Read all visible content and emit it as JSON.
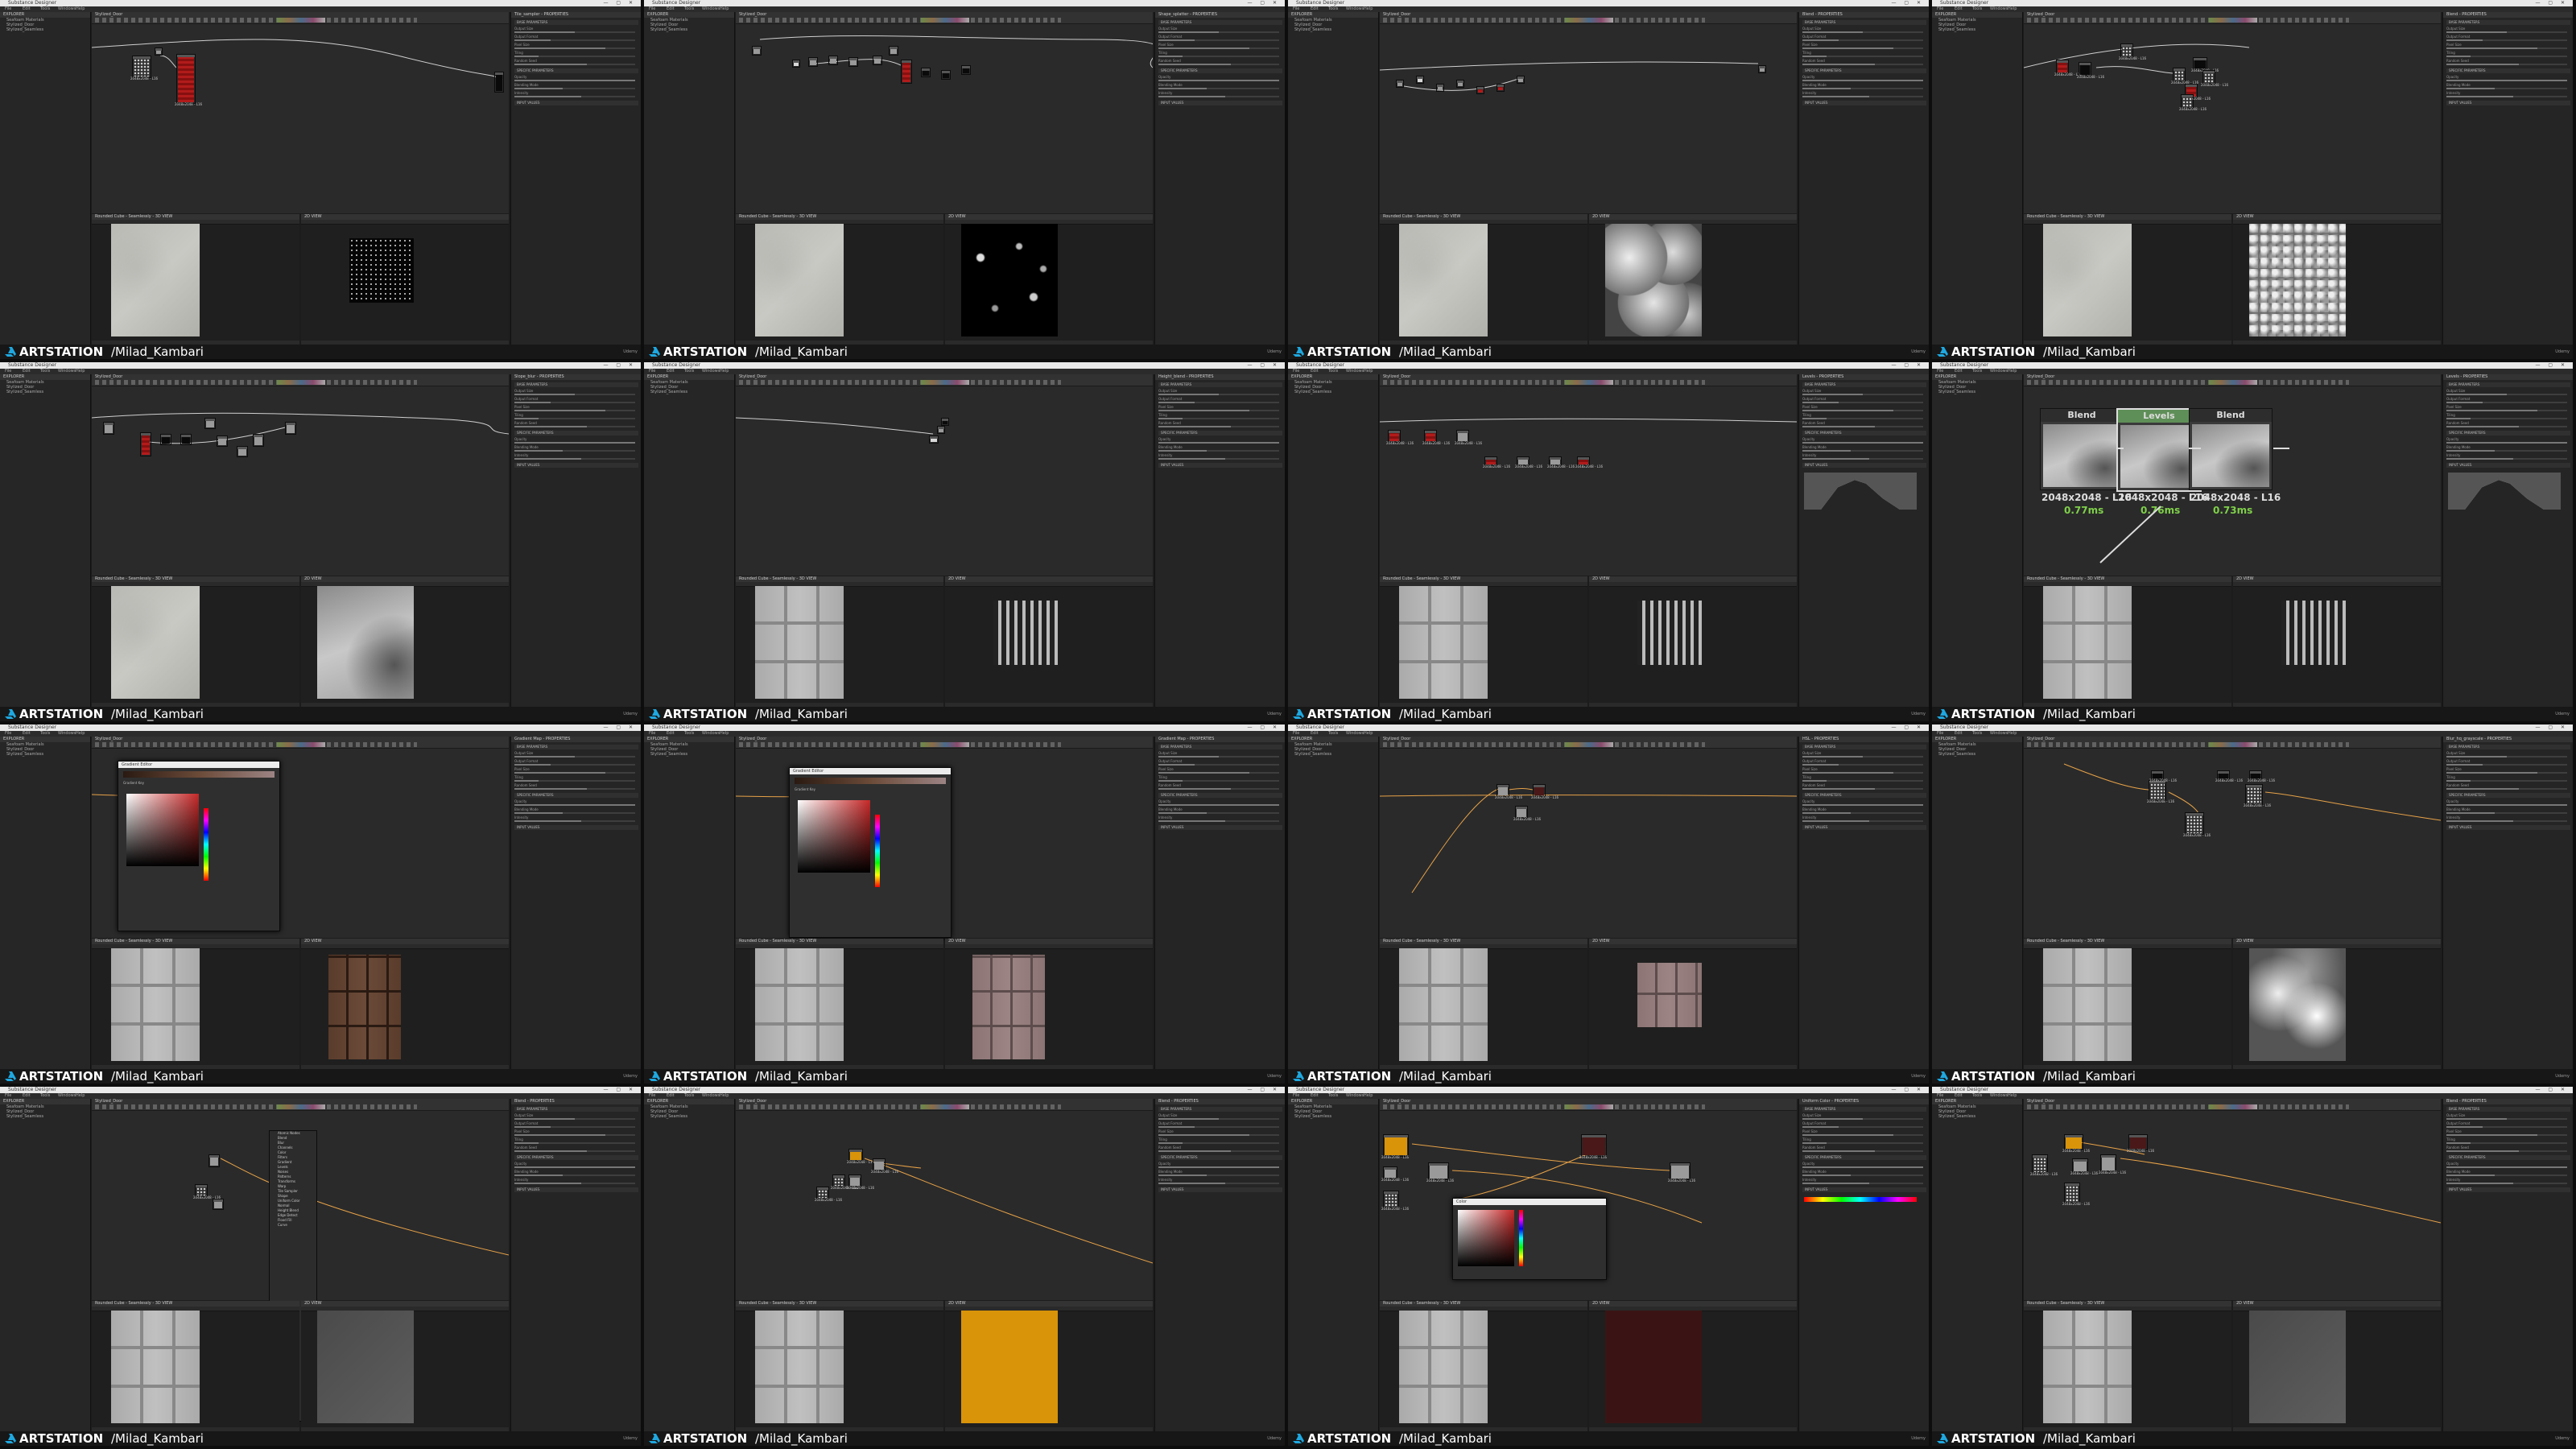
{
  "app": {
    "window_title": "Substance Designer",
    "menus": [
      "File",
      "Edit",
      "Tools",
      "Windows",
      "Help"
    ],
    "explorer_title": "EXPLORER",
    "explorer_items": [
      "Seafoam Materials",
      "Stylized_Door",
      "Stylized_Seamless"
    ],
    "graph_title": "Stylized_Door",
    "viewport3d_title": "Rounded Cube - Seamlessly - 3D VIEW",
    "viewport2d_title": "2D VIEW",
    "watermark_brand": "ARTSTATION",
    "watermark_user": "/Milad_Kambari",
    "udemy": "Udemy"
  },
  "tiles": [
    {
      "props_title": "Tile_sampler - PROPERTIES",
      "view2d": "tex-dots",
      "view3d": "tex-crack"
    },
    {
      "props_title": "Shape_splatter - PROPERTIES",
      "view2d": "tex-spots",
      "view3d": "tex-crack"
    },
    {
      "props_title": "Blend - PROPERTIES",
      "view2d": "tex-cells",
      "view3d": "tex-crack"
    },
    {
      "props_title": "Blend - PROPERTIES",
      "view2d": "tex-noise",
      "view3d": "tex-crack"
    },
    {
      "props_title": "Slope_blur - PROPERTIES",
      "view2d": "tex-blob",
      "view3d": "tex-crack"
    },
    {
      "props_title": "Height_blend - PROPERTIES",
      "view2d": "tex-grate",
      "view3d": "tex-door"
    },
    {
      "props_title": "Levels - PROPERTIES",
      "view2d": "tex-grate",
      "view3d": "tex-door"
    },
    {
      "props_title": "Levels - PROPERTIES",
      "view2d": "tex-grate",
      "view3d": "tex-door"
    },
    {
      "props_title": "Gradient Map - PROPERTIES",
      "view2d": "tex-wood",
      "view3d": "tex-door"
    },
    {
      "props_title": "Gradient Map - PROPERTIES",
      "view2d": "tex-pink",
      "view3d": "tex-door"
    },
    {
      "props_title": "HSL - PROPERTIES",
      "view2d": "tex-pink",
      "view3d": "tex-door"
    },
    {
      "props_title": "Blur_hq_grayscale - PROPERTIES",
      "view2d": "tex-cloud",
      "view3d": "tex-door"
    },
    {
      "props_title": "Blend - PROPERTIES",
      "view2d": "tex-gray",
      "view3d": "tex-door"
    },
    {
      "props_title": "Blend - PROPERTIES",
      "view2d": "tex-orange",
      "view3d": "tex-door"
    },
    {
      "props_title": "Uniform Color - PROPERTIES",
      "view2d": "tex-maroon",
      "view3d": "tex-door"
    },
    {
      "props_title": "Blend - PROPERTIES",
      "view2d": "tex-gray",
      "view3d": "tex-door"
    }
  ],
  "big_nodes": {
    "labels": [
      "Blend",
      "Levels",
      "Blend"
    ],
    "size_label": "2048x2048 - L16",
    "times": [
      "0.77ms",
      "0.76ms",
      "0.73ms"
    ]
  },
  "node_size": "2048x2048 - L16",
  "dialogs": {
    "gradient_title": "Gradient Editor",
    "gradient_label": "Gradient Key",
    "color_title": "Color"
  },
  "context_menu": [
    "Atomic Nodes",
    "Blend",
    "Blur",
    "Channels",
    "Color",
    "Filters",
    "Gradient",
    "Levels",
    "Noises",
    "Patterns",
    "Transforms",
    "Warp",
    "Tile Sampler",
    "Shape",
    "Uniform Color",
    "Normal",
    "Height Blend",
    "Edge Detect",
    "Flood Fill",
    "Curve"
  ],
  "property_labels": [
    "Output Size",
    "Output Format",
    "Pixel Size",
    "Tiling",
    "Random Seed",
    "Opacity",
    "Blending Mode",
    "Intensity"
  ],
  "section_labels": [
    "BASE PARAMETERS",
    "SPECIFIC PARAMETERS",
    "INPUT VALUES"
  ],
  "colors": {
    "accent_green": "#7fd04a",
    "titlebar": "#e9e9e9",
    "graph_bg": "#2a2a2a",
    "orange": "#d9940a",
    "maroon": "#3a1414"
  }
}
